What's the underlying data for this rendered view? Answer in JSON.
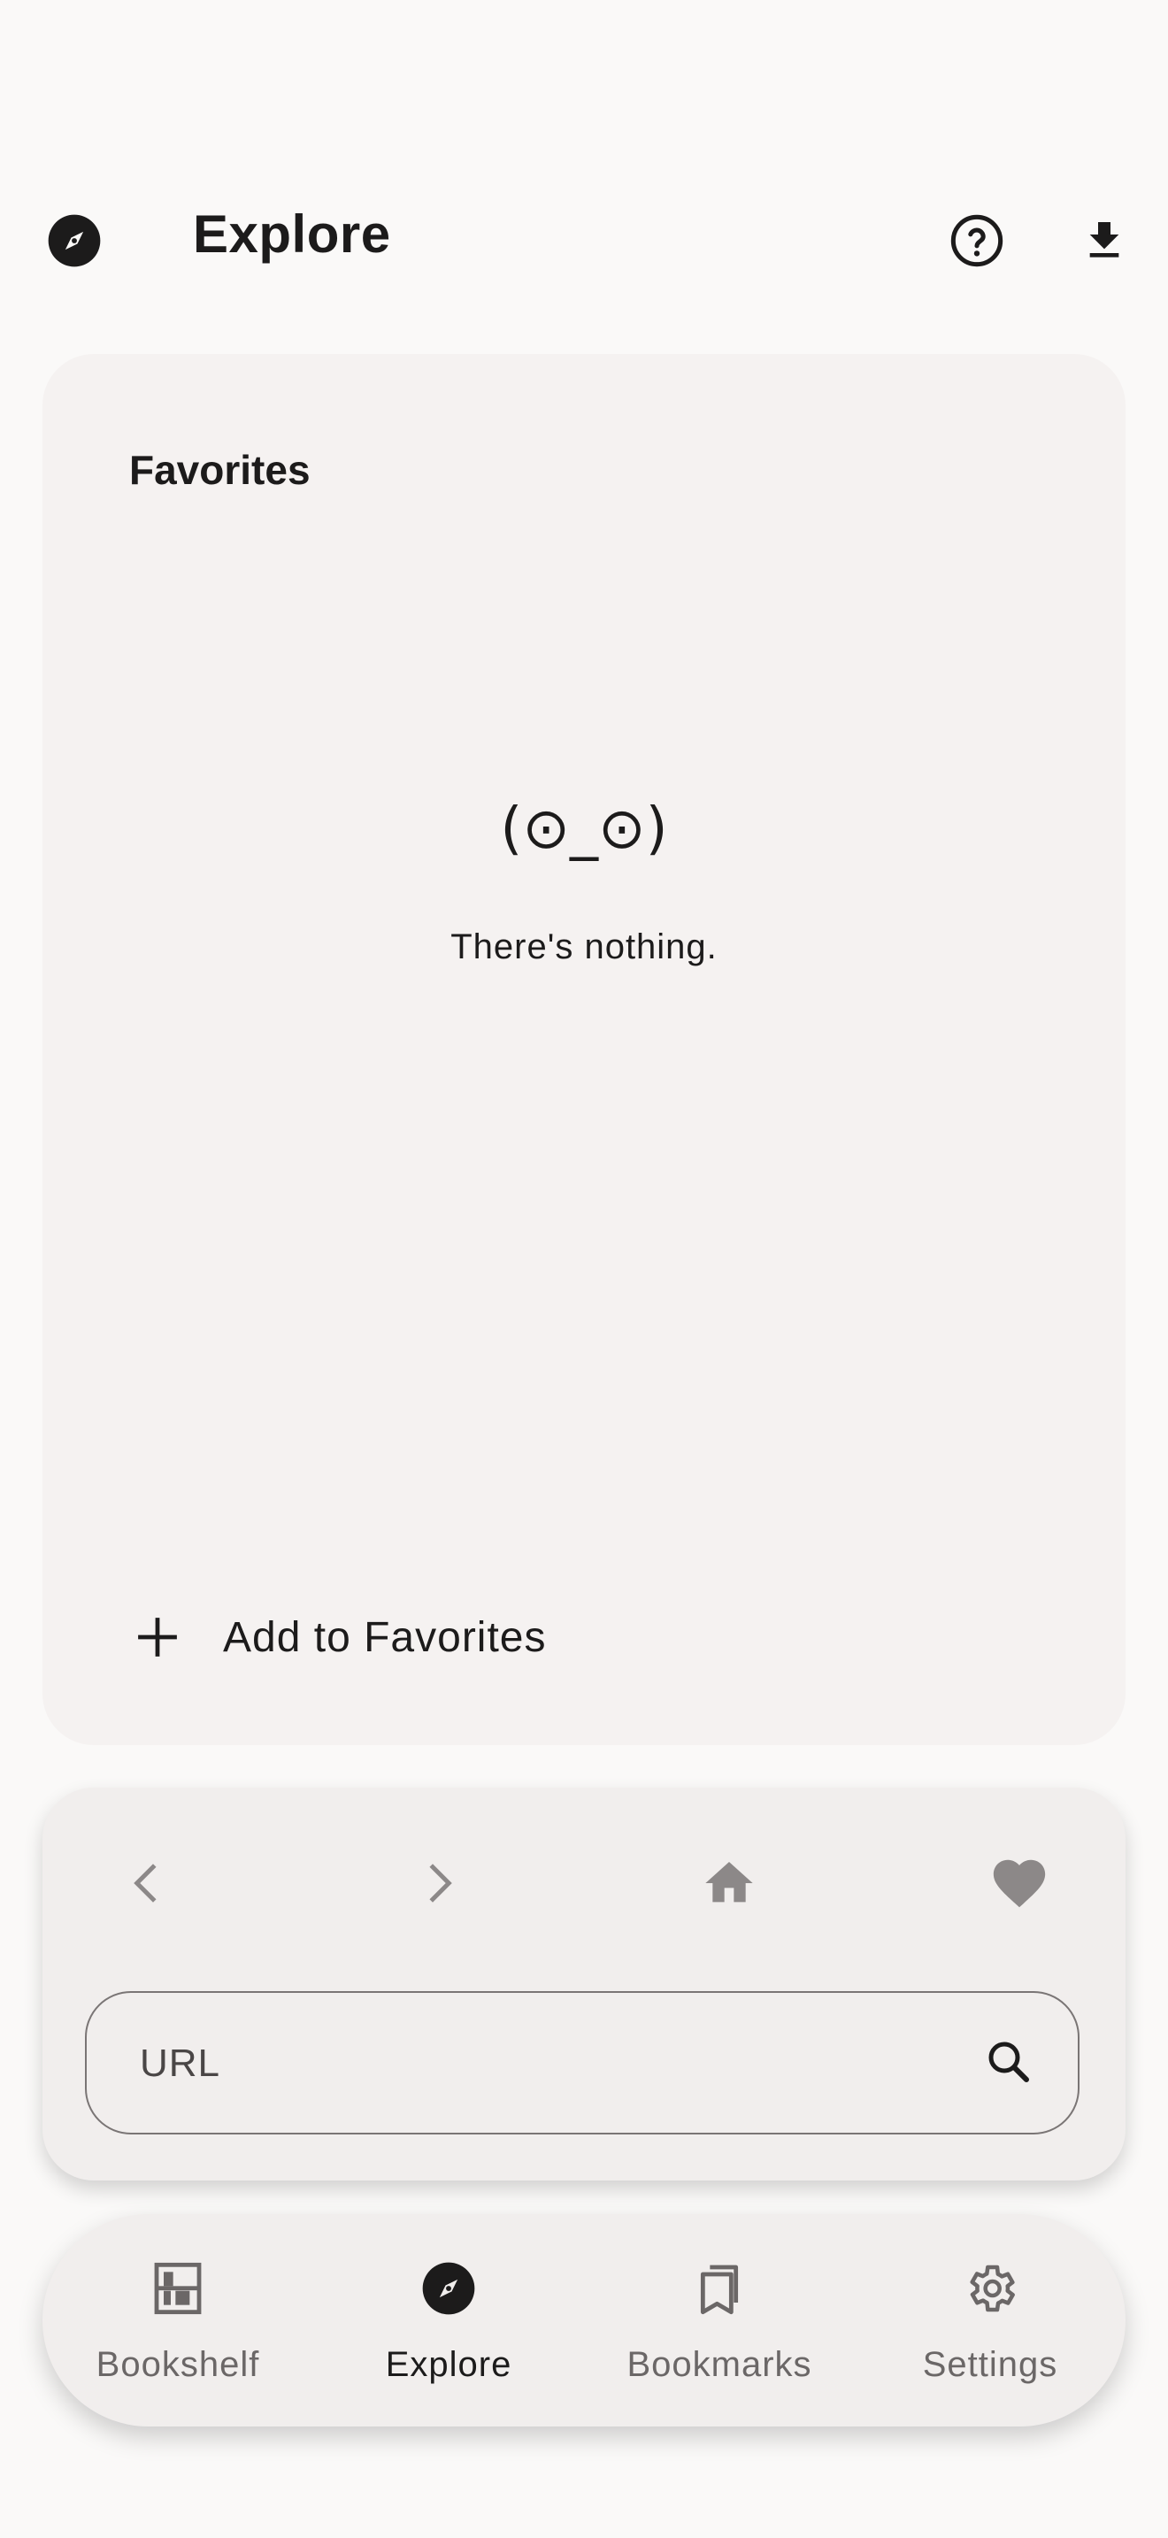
{
  "appbar": {
    "title": "Explore",
    "leading_icon": "compass-icon",
    "actions": [
      {
        "name": "help",
        "icon": "help-circle-icon"
      },
      {
        "name": "download",
        "icon": "download-icon"
      }
    ]
  },
  "favorites": {
    "title": "Favorites",
    "empty_face": "(⊙_⊙)",
    "empty_text": "There's nothing.",
    "add_label": "Add to Favorites",
    "add_icon": "plus-icon"
  },
  "browser": {
    "controls": [
      {
        "name": "back",
        "icon": "chevron-left-icon"
      },
      {
        "name": "forward",
        "icon": "chevron-right-icon"
      },
      {
        "name": "home",
        "icon": "home-icon"
      },
      {
        "name": "favorite",
        "icon": "heart-icon"
      }
    ],
    "url_placeholder": "URL",
    "url_value": "",
    "search_icon": "search-icon"
  },
  "bottom_nav": {
    "items": [
      {
        "label": "Bookshelf",
        "icon": "bookshelf-icon",
        "active": false
      },
      {
        "label": "Explore",
        "icon": "compass-icon",
        "active": true
      },
      {
        "label": "Bookmarks",
        "icon": "bookmarks-icon",
        "active": false
      },
      {
        "label": "Settings",
        "icon": "gear-icon",
        "active": false
      }
    ]
  },
  "colors": {
    "background": "#faf9f8",
    "card": "#f5f2f1",
    "panel": "#f1eeed",
    "text": "#1c1b1b",
    "muted_icon": "#8c8888",
    "inactive_label": "#6b6767"
  }
}
